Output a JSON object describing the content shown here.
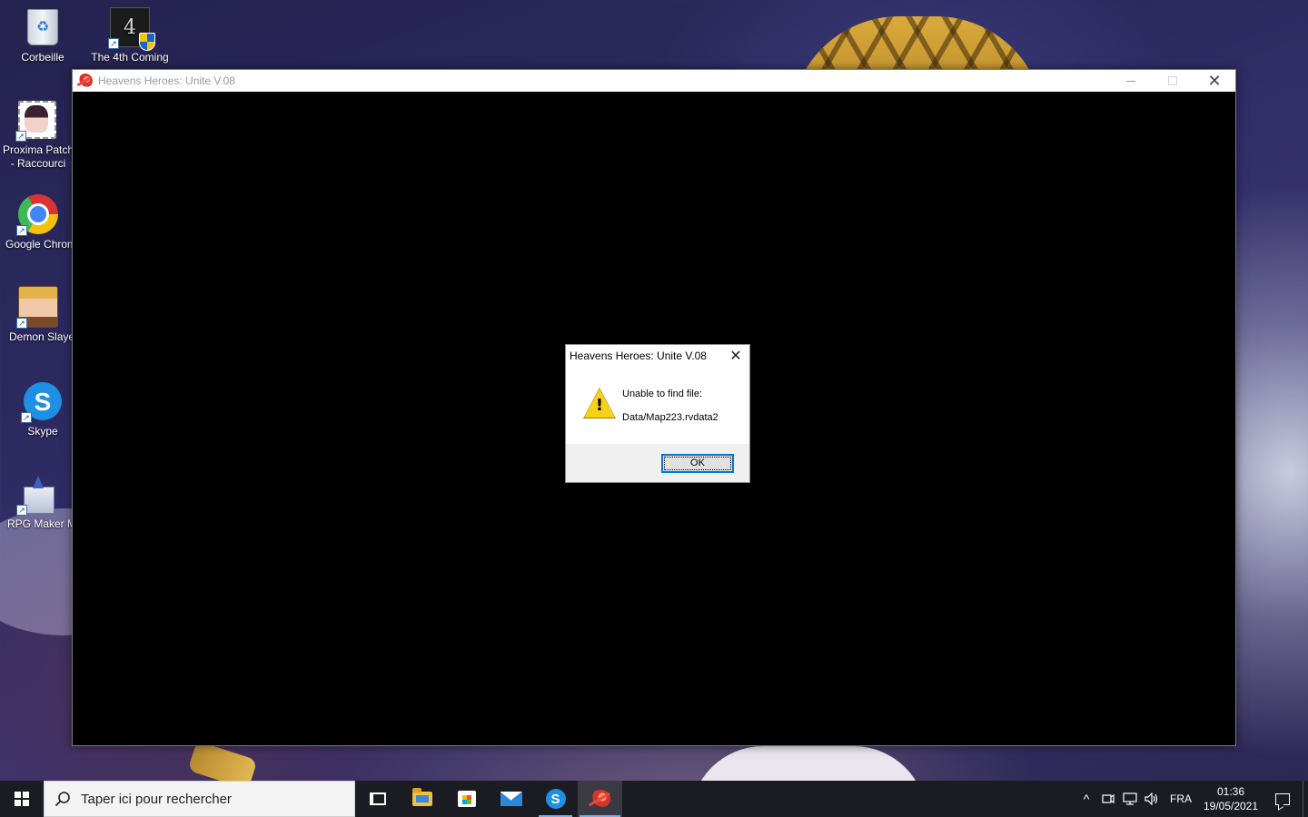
{
  "desktop": {
    "icons": [
      {
        "label": "Corbeille",
        "icon": "recycle-bin-icon"
      },
      {
        "label": "The 4th Coming",
        "icon": "the-4th-coming-icon"
      },
      {
        "label": "Proxima Patch - Raccourci",
        "icon": "proxima-patch-icon"
      },
      {
        "label": "Google Chrome",
        "icon": "chrome-icon"
      },
      {
        "label": "Demon Slayer",
        "icon": "demon-slayer-icon"
      },
      {
        "label": "Skype",
        "icon": "skype-icon"
      },
      {
        "label": "RPG Maker MV",
        "icon": "rpg-maker-icon"
      }
    ]
  },
  "game_window": {
    "title": "Heavens Heroes: Unite V.08",
    "controls": {
      "minimize": "—",
      "maximize": "☐",
      "close": "✕"
    }
  },
  "error_dialog": {
    "title": "Heavens Heroes: Unite V.08",
    "close": "✕",
    "message_line1": "Unable to find file:",
    "message_line2": "Data/Map223.rvdata2",
    "ok_label": "OK",
    "icon": "warning-icon"
  },
  "taskbar": {
    "search_placeholder": "Taper ici pour rechercher",
    "pinned": [
      "task-view-icon",
      "file-explorer-icon",
      "store-icon",
      "mail-icon",
      "skype-icon",
      "game-app-icon"
    ],
    "tray": {
      "chevron": "^",
      "language": "FRA",
      "time": "01:36",
      "date": "19/05/2021"
    }
  },
  "colors": {
    "accent": "#0078d7",
    "taskbar": "#1b1b22",
    "warning": "#f7d117"
  }
}
